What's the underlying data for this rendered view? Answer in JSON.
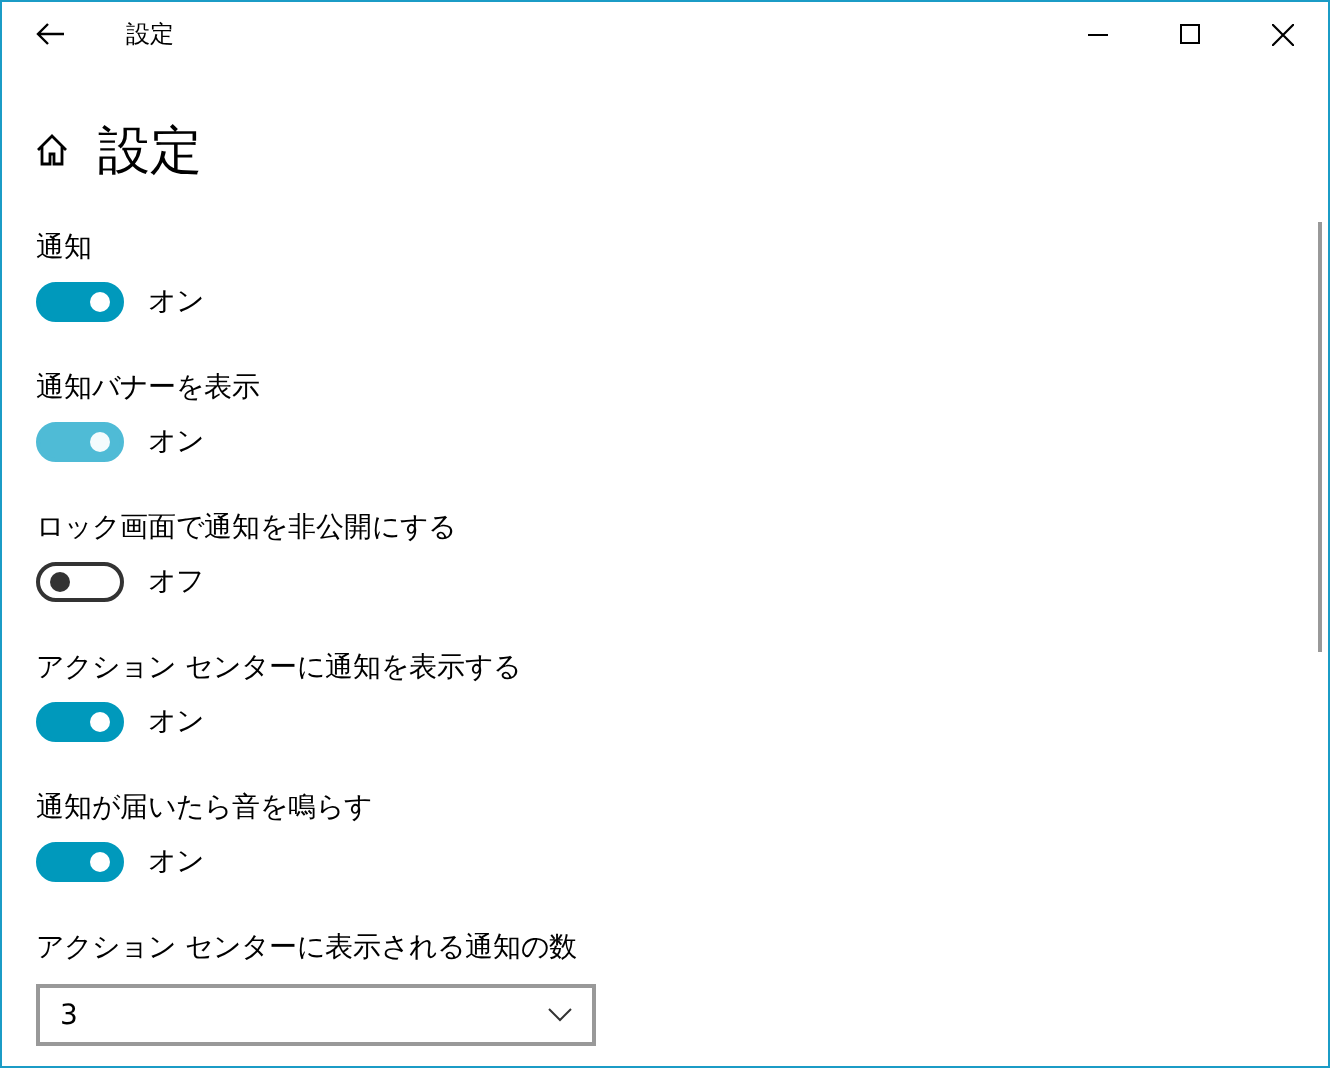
{
  "window": {
    "title": "設定"
  },
  "page": {
    "title": "設定"
  },
  "settings": [
    {
      "kind": "toggle",
      "label": "通知",
      "on": true,
      "hovered": false,
      "state_text": "オン"
    },
    {
      "kind": "toggle",
      "label": "通知バナーを表示",
      "on": true,
      "hovered": true,
      "state_text": "オン"
    },
    {
      "kind": "toggle",
      "label": "ロック画面で通知を非公開にする",
      "on": false,
      "hovered": false,
      "state_text": "オフ"
    },
    {
      "kind": "toggle",
      "label": "アクション センターに通知を表示する",
      "on": true,
      "hovered": false,
      "state_text": "オン"
    },
    {
      "kind": "toggle",
      "label": "通知が届いたら音を鳴らす",
      "on": true,
      "hovered": false,
      "state_text": "オン"
    },
    {
      "kind": "dropdown",
      "label": "アクション センターに表示される通知の数",
      "value": "3"
    }
  ]
}
